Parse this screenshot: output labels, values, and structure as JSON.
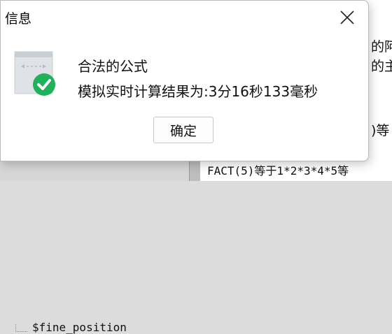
{
  "dialog": {
    "title": "信息",
    "icon": "formula-check-icon",
    "message_line1": "合法的公式",
    "message_line2": "模拟实时计算结果为:3分16秒133毫秒",
    "ok_label": "确定",
    "close_icon": "close-icon"
  },
  "background": {
    "tree_item": "$fine_position",
    "right_fragments": [
      "的阿",
      "的主",
      ")等"
    ],
    "formula_line": "FACT(5)等于1*2*3*4*5等"
  },
  "colors": {
    "success_green": "#1fb25a",
    "icon_gray": "#c9ced3"
  }
}
